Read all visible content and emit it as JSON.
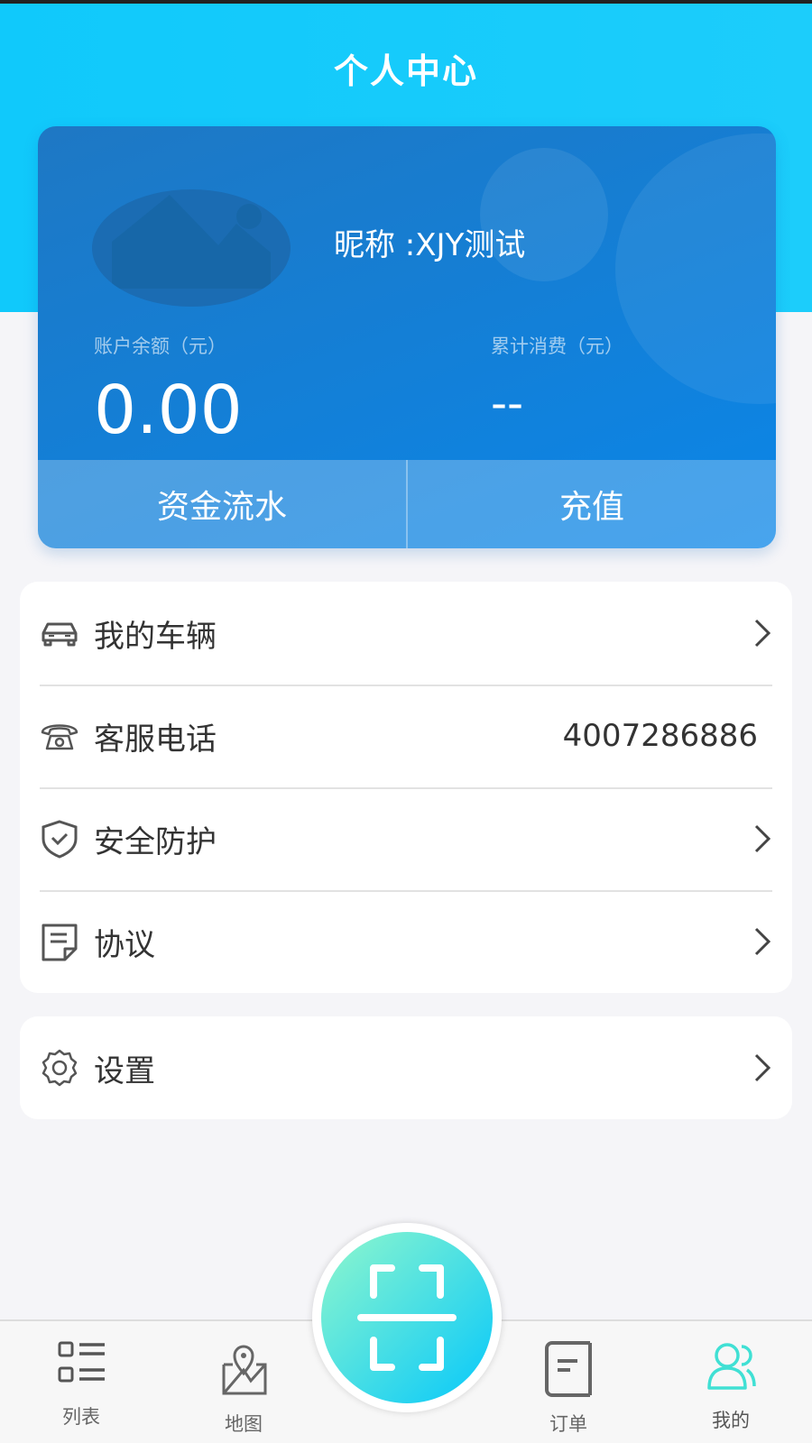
{
  "header": {
    "title": "个人中心"
  },
  "account": {
    "nickname": "昵称 :XJY测试",
    "balance_label": "账户余额（元）",
    "balance": "0.00",
    "spent_label": "累计消费（元）",
    "spent": "--",
    "flow_button": "资金流水",
    "recharge_button": "充值"
  },
  "menu": {
    "items": [
      {
        "label": "我的车辆",
        "icon": "car-icon"
      },
      {
        "label": "客服电话",
        "icon": "telephone-icon",
        "value": "4007286886"
      },
      {
        "label": "安全防护",
        "icon": "shield-icon"
      },
      {
        "label": "协议",
        "icon": "document-icon"
      }
    ],
    "settings": {
      "label": "设置",
      "icon": "gear-icon"
    }
  },
  "tabbar": {
    "items": [
      {
        "label": "列表",
        "icon": "list-icon"
      },
      {
        "label": "地图",
        "icon": "map-icon"
      },
      {
        "label": "订单",
        "icon": "order-icon"
      },
      {
        "label": "我的",
        "icon": "users-icon",
        "active": true
      }
    ],
    "scan_icon": "scan-icon"
  },
  "colors": {
    "header": "#10c9fb",
    "active_tab": "#3fe0d8",
    "card": "#0a86e8"
  }
}
